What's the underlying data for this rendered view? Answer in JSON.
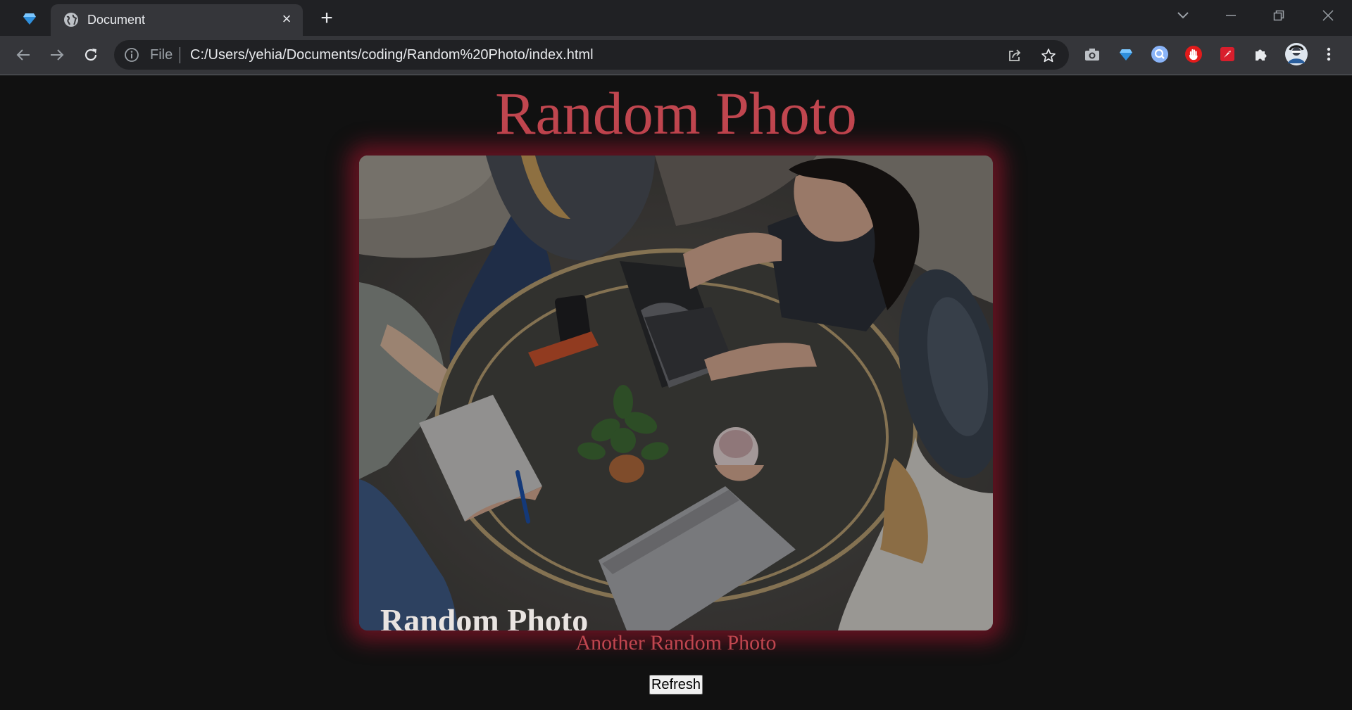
{
  "browser": {
    "tab_title": "Document",
    "new_tab_symbol": "+",
    "close_symbol": "×",
    "scheme_label": "File",
    "url": "C:/Users/yehia/Documents/coding/Random%20Photo/index.html",
    "icons": [
      "gem-icon",
      "globe-icon",
      "back-icon",
      "forward-icon",
      "reload-icon",
      "info-icon",
      "share-icon",
      "star-icon",
      "camera-icon",
      "gem-extension-icon",
      "search-extension-icon",
      "hand-stop-extension-icon",
      "rocket-extension-icon",
      "puzzle-icon",
      "avatar",
      "more-menu-icon",
      "tab-search-icon",
      "minimize-icon",
      "restore-icon",
      "window-close-icon"
    ]
  },
  "page": {
    "heading": "Random Photo",
    "photo_caption": "Random Photo",
    "link_text": "Another Random Photo",
    "refresh_label": "Refresh",
    "accent_color": "#c0464f",
    "glow_color": "#a5142d",
    "background_color": "#111111"
  }
}
